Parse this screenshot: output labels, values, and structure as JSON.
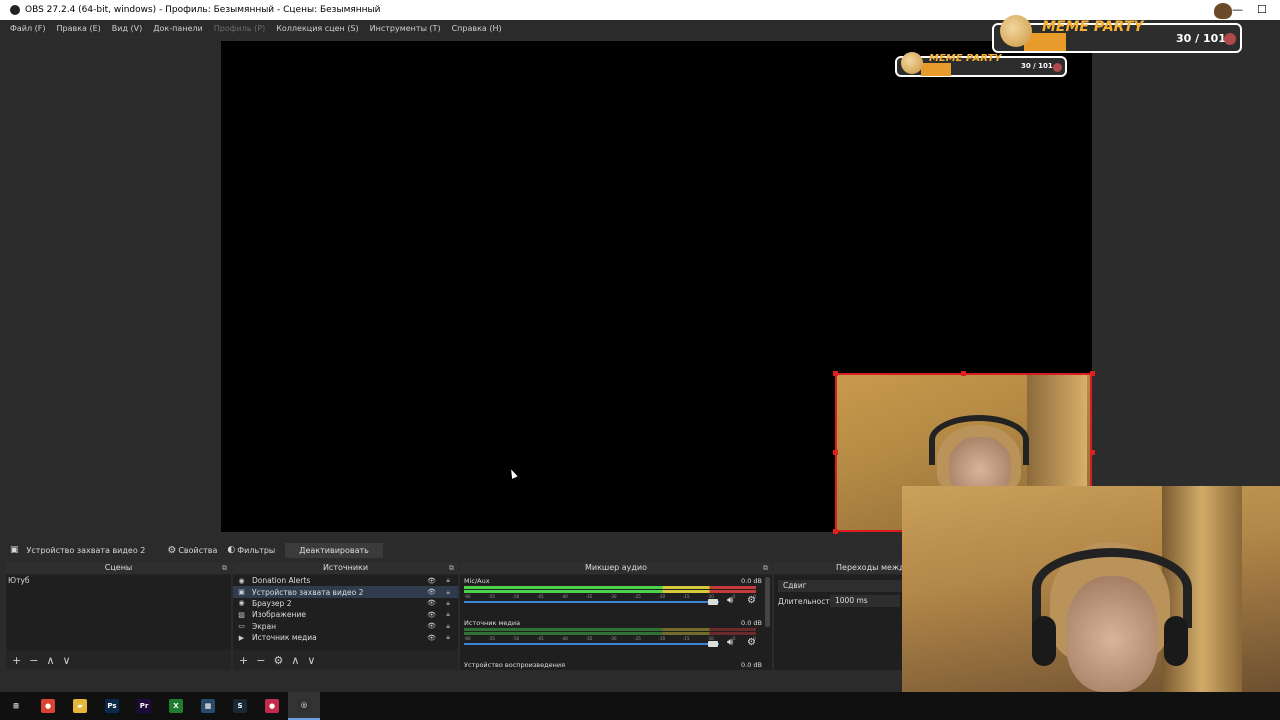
{
  "window": {
    "title": "OBS 27.2.4 (64-bit, windows) - Профиль: Безымянный - Сцены: Безымянный",
    "minimize": "—",
    "maximize": "☐"
  },
  "menu": {
    "items": [
      {
        "label": "Файл (F)",
        "enabled": true
      },
      {
        "label": "Правка (E)",
        "enabled": true
      },
      {
        "label": "Вид (V)",
        "enabled": true
      },
      {
        "label": "Док-панели",
        "enabled": true
      },
      {
        "label": "Профиль (P)",
        "enabled": false
      },
      {
        "label": "Коллекция сцен (S)",
        "enabled": true
      },
      {
        "label": "Инструменты (T)",
        "enabled": true
      },
      {
        "label": "Справка (H)",
        "enabled": true
      }
    ]
  },
  "overlay": {
    "meme_title": "MEME PARTY",
    "meme_count": "30 / 101",
    "meme_title_small": "MEME PARTY",
    "meme_count_small": "30 / 101"
  },
  "source_toolbar": {
    "source_name": "Устройство захвата видео 2",
    "properties_label": "Свойства",
    "filters_label": "Фильтры",
    "deactivate_label": "Деактивировать"
  },
  "scenes": {
    "title": "Сцены",
    "items": [
      "Ютуб"
    ]
  },
  "sources": {
    "title": "Источники",
    "items": [
      {
        "icon": "globe-icon",
        "glyph": "◉",
        "label": "Donation Alerts",
        "selected": false
      },
      {
        "icon": "camera-icon",
        "glyph": "▣",
        "label": "Устройство захвата видео 2",
        "selected": true
      },
      {
        "icon": "globe-icon",
        "glyph": "◉",
        "label": "Браузер 2",
        "selected": false
      },
      {
        "icon": "image-icon",
        "glyph": "▨",
        "label": "Изображение",
        "selected": false
      },
      {
        "icon": "monitor-icon",
        "glyph": "▭",
        "label": "Экран",
        "selected": false
      },
      {
        "icon": "play-icon",
        "glyph": "▶",
        "label": "Источник медиа",
        "selected": false
      }
    ]
  },
  "mixer": {
    "title": "Микшер аудио",
    "channels": [
      {
        "name": "Mic/Aux",
        "db": "0.0 dB",
        "volume": 0.97,
        "level": 0.85
      },
      {
        "name": "Источник медиа",
        "db": "0.0 dB",
        "volume": 0.97,
        "level": 0.0
      },
      {
        "name": "Устройство воспроизведения",
        "db": "0.0 dB"
      }
    ],
    "scale": [
      "-60",
      "-55",
      "-50",
      "-45",
      "-40",
      "-35",
      "-30",
      "-25",
      "-20",
      "-15",
      "-10",
      "-5",
      "0"
    ]
  },
  "transitions": {
    "title": "Переходы между",
    "type": "Сдвиг",
    "duration_label": "Длительность",
    "duration_value": "1000 ms"
  },
  "dock_controls": {
    "add": "+",
    "remove": "−",
    "up": "∧",
    "down": "∨",
    "settings": "⚙"
  },
  "taskbar": {
    "apps": [
      {
        "icon": "windows-start-icon",
        "glyph": "⊞",
        "color": "#101010"
      },
      {
        "icon": "chrome-icon",
        "glyph": "●",
        "color": "#d9432f"
      },
      {
        "icon": "file-explorer-icon",
        "glyph": "▰",
        "color": "#e8b53c"
      },
      {
        "icon": "photoshop-icon",
        "glyph": "Ps",
        "color": "#0b2a4a"
      },
      {
        "icon": "premiere-icon",
        "glyph": "Pr",
        "color": "#1f0a3a"
      },
      {
        "icon": "xbox-icon",
        "glyph": "X",
        "color": "#1e7d2e"
      },
      {
        "icon": "calculator-icon",
        "glyph": "▦",
        "color": "#2a4a6a"
      },
      {
        "icon": "steam-icon",
        "glyph": "S",
        "color": "#1b2838"
      },
      {
        "icon": "recorder-icon",
        "glyph": "●",
        "color": "#c22b4c"
      },
      {
        "icon": "obs-icon",
        "glyph": "◎",
        "color": "#303030"
      }
    ]
  }
}
